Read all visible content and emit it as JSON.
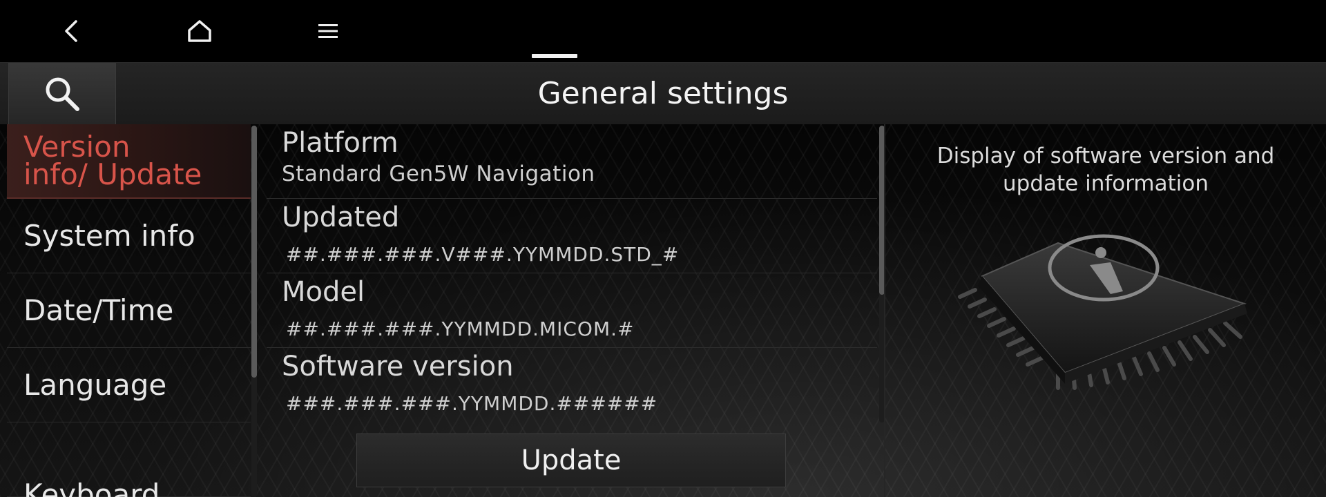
{
  "header": {
    "title": "General settings"
  },
  "topbar": {
    "icons": {
      "back": "back-arrow-icon",
      "home": "home-icon",
      "menu": "menu-icon",
      "search": "search-icon"
    }
  },
  "sidebar": {
    "items": [
      {
        "label": "Version info/ Update",
        "active": true
      },
      {
        "label": "System info"
      },
      {
        "label": "Date/Time"
      },
      {
        "label": "Language"
      },
      {
        "label": "Keyboard"
      }
    ]
  },
  "info": {
    "rows": [
      {
        "label": "Platform",
        "value": "Standard Gen5W Navigation"
      },
      {
        "label": "Updated",
        "value": "##.###.###.V###.YYMMDD.STD_#"
      },
      {
        "label": "Model",
        "value": "##.###.###.YYMMDD.MICOM.#"
      },
      {
        "label": "Software version",
        "value": "###.###.###.YYMMDD.######"
      }
    ],
    "update_label": "Update"
  },
  "panel": {
    "description": "Display of software version and update information",
    "illustration_icon": "info-chip-icon"
  },
  "colors": {
    "accent": "#d8544a",
    "background": "#000000",
    "text": "#e6e6e6"
  }
}
